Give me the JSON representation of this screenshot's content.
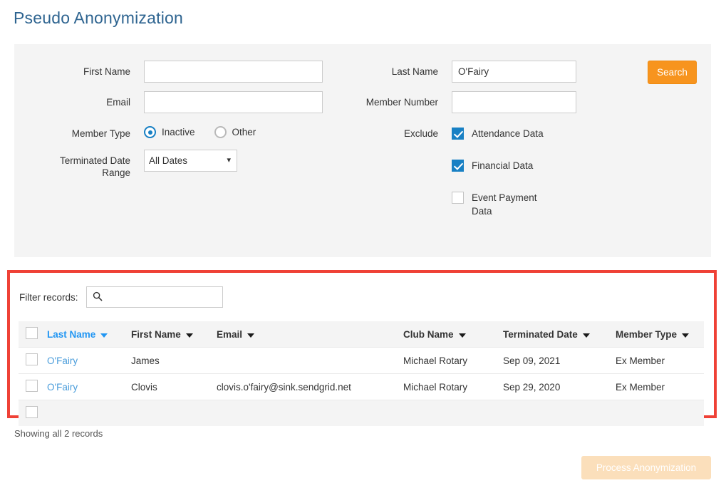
{
  "page": {
    "title": "Pseudo Anonymization"
  },
  "theme": {
    "title_color": "#2e6490",
    "accent_orange": "#f7941e",
    "accent_blue": "#1880c4",
    "link_blue": "#4a9ddb",
    "sorted_header_blue": "#2196f3",
    "highlight_red": "#ef4136",
    "panel_gray": "#f4f4f4",
    "disabled_orange": "#fbdfbb"
  },
  "search_form": {
    "fields": {
      "first_name": {
        "label": "First Name",
        "value": "",
        "placeholder": ""
      },
      "email": {
        "label": "Email",
        "value": "",
        "placeholder": ""
      },
      "last_name": {
        "label": "Last Name",
        "value": "O'Fairy",
        "placeholder": ""
      },
      "member_number": {
        "label": "Member Number",
        "value": "",
        "placeholder": ""
      }
    },
    "member_type": {
      "label": "Member Type",
      "options": [
        {
          "label": "Inactive",
          "selected": true
        },
        {
          "label": "Other",
          "selected": false
        }
      ]
    },
    "terminated_date_range": {
      "label": "Terminated Date Range",
      "label_line1": "Terminated Date",
      "label_line2": "Range",
      "selected": "All Dates",
      "options": [
        "All Dates"
      ]
    },
    "exclude": {
      "label": "Exclude",
      "items": [
        {
          "label": "Attendance Data",
          "checked": true
        },
        {
          "label": "Financial Data",
          "checked": true
        },
        {
          "label": "Event Payment Data",
          "checked": false
        }
      ]
    },
    "search_button": "Search"
  },
  "results": {
    "filter": {
      "label": "Filter records:",
      "value": "",
      "placeholder": "",
      "icon": "search-icon"
    },
    "columns": [
      {
        "key": "last_name",
        "label": "Last Name",
        "sorted": true
      },
      {
        "key": "first_name",
        "label": "First Name",
        "sorted": false
      },
      {
        "key": "email",
        "label": "Email",
        "sorted": false
      },
      {
        "key": "club_name",
        "label": "Club Name",
        "sorted": false
      },
      {
        "key": "terminated_date",
        "label": "Terminated Date",
        "sorted": false
      },
      {
        "key": "member_type",
        "label": "Member Type",
        "sorted": false
      }
    ],
    "rows": [
      {
        "last_name": "O'Fairy",
        "first_name": "James",
        "email": "",
        "club_name": "Michael Rotary",
        "terminated_date": "Sep 09, 2021",
        "member_type": "Ex Member",
        "selected": false
      },
      {
        "last_name": "O'Fairy",
        "first_name": "Clovis",
        "email": "clovis.o'fairy@sink.sendgrid.net",
        "club_name": "Michael Rotary",
        "terminated_date": "Sep 29, 2020",
        "member_type": "Ex Member",
        "selected": false
      }
    ],
    "showing_text": "Showing all 2 records"
  },
  "footer": {
    "process_button": "Process Anonymization",
    "process_button_disabled": true
  }
}
